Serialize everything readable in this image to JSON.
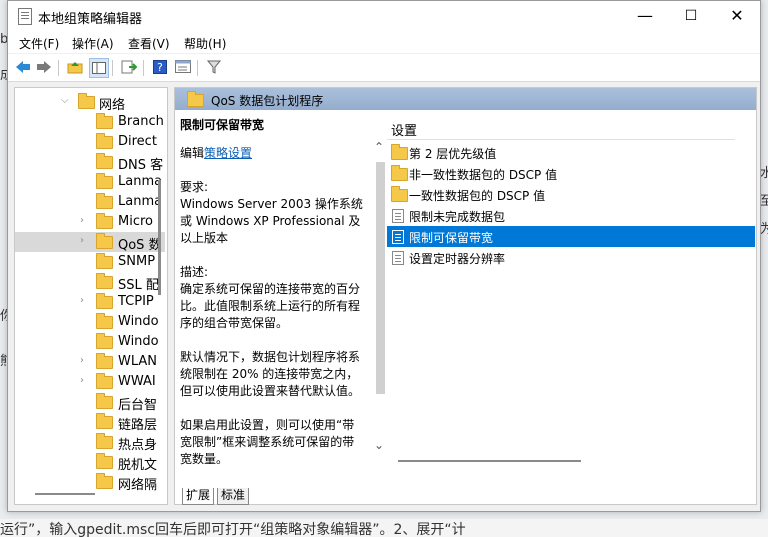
{
  "window": {
    "title": "本地组策略编辑器",
    "controls": {
      "minimize": "—",
      "maximize": "☐",
      "close": "✕"
    }
  },
  "menu": [
    "文件(F)",
    "操作(A)",
    "查看(V)",
    "帮助(H)"
  ],
  "toolbar": [
    "back-icon",
    "forward-icon",
    "up-folder-icon",
    "show-hide-tree-icon",
    "export-list-icon",
    "help-icon",
    "properties-icon",
    "filter-icon"
  ],
  "tree": {
    "items": [
      {
        "label": "网络",
        "expander": "open"
      },
      {
        "label": "Branch",
        "expander": ""
      },
      {
        "label": "Direct",
        "expander": ""
      },
      {
        "label": "DNS 客",
        "expander": ""
      },
      {
        "label": "Lanma",
        "expander": ""
      },
      {
        "label": "Lanma",
        "expander": ""
      },
      {
        "label": "Micro",
        "expander": "closed"
      },
      {
        "label": "QoS 数",
        "expander": "closed"
      },
      {
        "label": "SNMP",
        "expander": ""
      },
      {
        "label": "SSL 配",
        "expander": ""
      },
      {
        "label": "TCPIP",
        "expander": "closed"
      },
      {
        "label": "Windo",
        "expander": ""
      },
      {
        "label": "Windo",
        "expander": ""
      },
      {
        "label": "WLAN",
        "expander": "closed"
      },
      {
        "label": "WWAI",
        "expander": "closed"
      },
      {
        "label": "后台智",
        "expander": ""
      },
      {
        "label": "链路层",
        "expander": ""
      },
      {
        "label": "热点身",
        "expander": ""
      },
      {
        "label": "脱机文",
        "expander": ""
      },
      {
        "label": "网络隔",
        "expander": ""
      }
    ]
  },
  "right": {
    "header": "QoS 数据包计划程序",
    "description": {
      "title": "限制可保留带宽",
      "edit_prefix": "编辑",
      "edit_link": "策略设置",
      "req_label": "要求:",
      "req_text": "Windows Server 2003 操作系统或 Windows XP Professional 及以上版本",
      "desc_label": "描述:",
      "desc_text": "确定系统可保留的连接带宽的百分比。此值限制系统上运行的所有程序的组合带宽保留。",
      "para2": "默认情况下，数据包计划程序将系统限制在 20% 的连接带宽之内，但可以使用此设置来替代默认值。",
      "para3": "如果启用此设置，则可以使用“带宽限制”框来调整系统可保留的带宽数量。"
    },
    "column_header": "设置",
    "items": [
      {
        "label": "第 2 层优先级值",
        "type": "folder"
      },
      {
        "label": "非一致性数据包的 DSCP 值",
        "type": "folder"
      },
      {
        "label": "一致性数据包的 DSCP 值",
        "type": "folder"
      },
      {
        "label": "限制未完成数据包",
        "type": "setting"
      },
      {
        "label": "限制可保留带宽",
        "type": "setting",
        "selected": true
      },
      {
        "label": "设置定时器分辨率",
        "type": "setting"
      }
    ],
    "tabs": [
      "扩展",
      "标准"
    ]
  },
  "background": {
    "left_fragments": [
      "b",
      "成",
      "你",
      "熊"
    ],
    "right_fragments": [
      "水",
      "至",
      "为"
    ],
    "bottom_text": "运行”，输入gpedit.msc回车后即可打开“组策略对象编辑器”。2、展开“计"
  }
}
